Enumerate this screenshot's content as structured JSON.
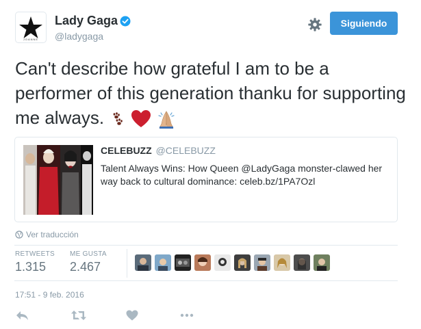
{
  "user": {
    "name": "Lady Gaga",
    "handle": "@ladygaga",
    "avatar_caption": "JOANNE"
  },
  "follow_button": {
    "label": "Siguiendo"
  },
  "tweet": {
    "text": "Can't describe how grateful I am to be a performer of this generation thanku for supporting me always."
  },
  "quoted": {
    "author_name": "CELEBUZZ",
    "author_handle": "@CELEBUZZ",
    "text": "Talent Always Wins: How Queen @LadyGaga monster-clawed her way back to cultural dominance: celeb.bz/1PA7Ozl"
  },
  "translate_label": "Ver traducción",
  "stats": {
    "retweets_label": "RETWEETS",
    "retweets_value": "1.315",
    "likes_label": "ME GUSTA",
    "likes_value": "2.467"
  },
  "timestamp": "17:51 - 9 feb. 2016",
  "colors": {
    "accent": "#3b94d9",
    "verified": "#1da1f2",
    "secondary_text": "#8899a6",
    "heart_emoji": "#cc1f2f"
  },
  "icons": [
    "verified-badge-icon",
    "gear-icon",
    "globe-icon",
    "reply-icon",
    "retweet-icon",
    "like-icon",
    "more-icon"
  ]
}
